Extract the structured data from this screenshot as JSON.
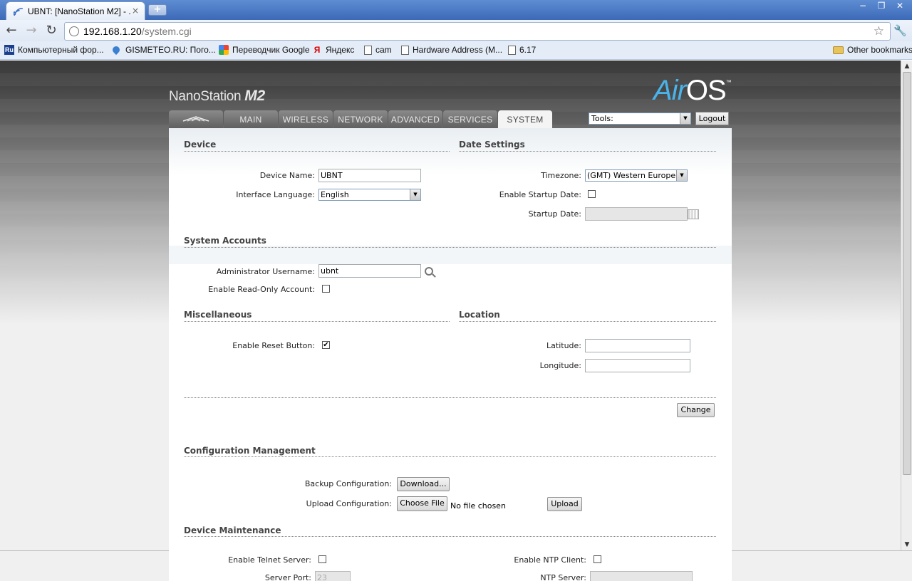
{
  "browser": {
    "tab_title": "UBNT: [NanoStation M2] - ...",
    "tab_close": "×",
    "new_tab": "+",
    "window_buttons": [
      "−",
      "❐",
      "✕"
    ],
    "url_host": "192.168.1.20",
    "url_path": "/system.cgi",
    "bookmarks": [
      {
        "label": "Компьютерный фор...",
        "icon": "ru-icon"
      },
      {
        "label": "GISMETEO.RU: Пого...",
        "icon": "drop-icon"
      },
      {
        "label": "Переводчик Google",
        "icon": "google-icon"
      },
      {
        "label": "Яндекс",
        "icon": "yandex-icon"
      },
      {
        "label": "cam",
        "icon": "page-icon"
      },
      {
        "label": "Hardware Address (M...",
        "icon": "page-icon"
      },
      {
        "label": "6.17",
        "icon": "page-icon"
      }
    ],
    "other_bookmarks": "Other bookmarks"
  },
  "header": {
    "product": "NanoStation",
    "model": "M2",
    "brand_air": "Air",
    "brand_os": "OS",
    "brand_tm": "™"
  },
  "nav": {
    "tabs": [
      "MAIN",
      "WIRELESS",
      "NETWORK",
      "ADVANCED",
      "SERVICES",
      "SYSTEM"
    ],
    "active": "SYSTEM",
    "tools_label": "Tools:",
    "logout": "Logout"
  },
  "device": {
    "heading": "Device",
    "name_label": "Device Name:",
    "name_value": "UBNT",
    "language_label": "Interface Language:",
    "language_value": "English"
  },
  "date_settings": {
    "heading": "Date Settings",
    "timezone_label": "Timezone:",
    "timezone_value": "(GMT) Western Europe T",
    "startup_enable_label": "Enable Startup Date:",
    "startup_enable_checked": false,
    "startup_date_label": "Startup Date:",
    "startup_date_value": ""
  },
  "accounts": {
    "heading": "System Accounts",
    "admin_label": "Administrator Username:",
    "admin_value": "ubnt",
    "readonly_label": "Enable Read-Only Account:",
    "readonly_checked": false
  },
  "misc": {
    "heading": "Miscellaneous",
    "reset_label": "Enable Reset Button:",
    "reset_checked": true,
    "check_mark": "✔"
  },
  "location": {
    "heading": "Location",
    "latitude_label": "Latitude:",
    "latitude_value": "",
    "longitude_label": "Longitude:",
    "longitude_value": ""
  },
  "change_button": "Change",
  "config": {
    "heading": "Configuration Management",
    "backup_label": "Backup Configuration:",
    "download_button": "Download...",
    "upload_label": "Upload Configuration:",
    "choose_file_button": "Choose File",
    "no_file_text": "No file chosen",
    "upload_button": "Upload"
  },
  "maintenance": {
    "heading": "Device Maintenance",
    "telnet_label": "Enable Telnet Server:",
    "telnet_checked": false,
    "server_port_label": "Server Port:",
    "server_port_value": "23",
    "ntp_label": "Enable NTP Client:",
    "ntp_checked": false,
    "ntp_server_label": "NTP Server:",
    "ntp_server_value": ""
  }
}
